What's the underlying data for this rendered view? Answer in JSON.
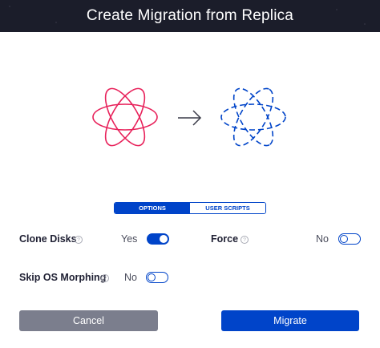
{
  "title": "Create Migration from Replica",
  "tabs": [
    {
      "label": "OPTIONS",
      "active": true
    },
    {
      "label": "USER SCRIPTS",
      "active": false
    }
  ],
  "options": {
    "clone_disks": {
      "label": "Clone Disks",
      "value": "Yes",
      "enabled": true
    },
    "force": {
      "label": "Force",
      "value": "No",
      "enabled": false
    },
    "skip_os_morphing": {
      "label": "Skip OS Morphing",
      "value": "No",
      "enabled": false
    }
  },
  "help_glyph": "?",
  "buttons": {
    "cancel": "Cancel",
    "migrate": "Migrate"
  },
  "colors": {
    "primary": "#0044c9",
    "header_bg": "#1b1d2a",
    "source_icon": "#e8225b",
    "target_icon": "#0044c9",
    "cancel_bg": "#7b7e8d"
  },
  "icons": [
    "source-replica-icon",
    "arrow-right-icon",
    "target-migration-icon",
    "help-icon"
  ]
}
